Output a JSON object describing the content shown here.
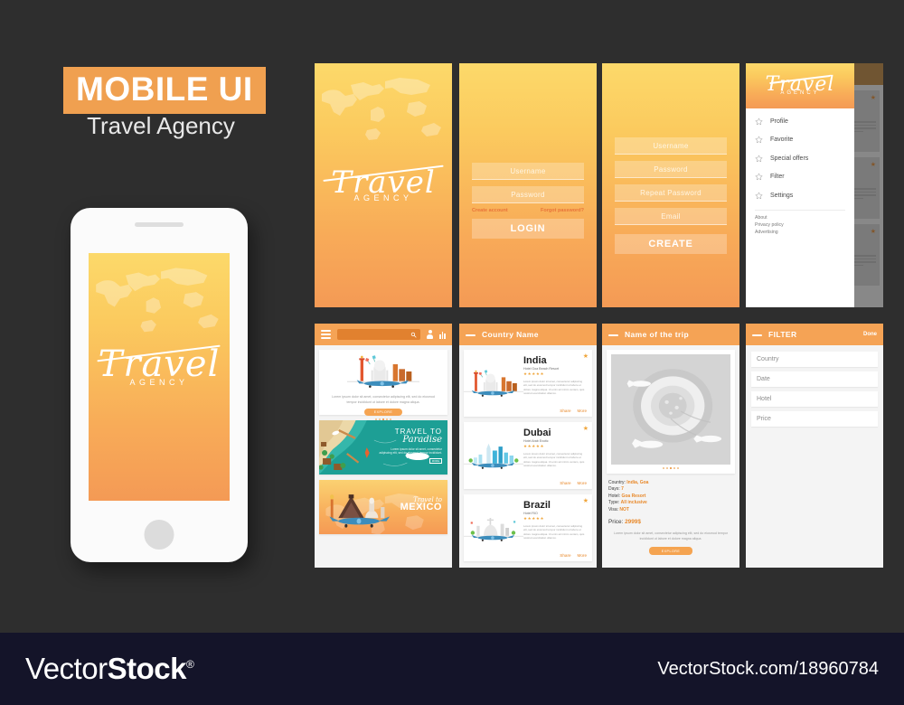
{
  "header": {
    "badge_title": "MOBILE UI",
    "subtitle": "Travel Agency",
    "badge_color": "#f0a050"
  },
  "brand": {
    "script": "Travel",
    "agency": "AGENCY"
  },
  "screens": {
    "splash": {
      "name": "splash-screen"
    },
    "login": {
      "username_placeholder": "Username",
      "password_placeholder": "Password",
      "create_account_link": "Create account",
      "forgot_password_link": "Forgot password?",
      "submit_label": "LOGIN"
    },
    "register": {
      "username_placeholder": "Username",
      "password_placeholder": "Password",
      "repeat_password_placeholder": "Repeat Password",
      "email_placeholder": "Email",
      "submit_label": "CREATE"
    },
    "drawer": {
      "items": [
        {
          "label": "Profile",
          "icon": "star-outline-icon"
        },
        {
          "label": "Favorite",
          "icon": "star-outline-icon"
        },
        {
          "label": "Special offers",
          "icon": "star-outline-icon"
        },
        {
          "label": "Filter",
          "icon": "star-outline-icon"
        },
        {
          "label": "Settings",
          "icon": "star-outline-icon"
        }
      ],
      "footer_links": [
        "About",
        "Privacy policy",
        "Advertising"
      ]
    },
    "home": {
      "search_placeholder": "",
      "hero": {
        "lorem": "Lorem ipsum dolor sit amet, consectetur adipiscing elit, sed do eiusmod tempor incididunt ut labore et dolore magna aliqua.",
        "cta": "EXPLORE"
      },
      "banners": [
        {
          "line1": "TRAVEL TO",
          "line2": "Paradise",
          "lorem": "Lorem ipsum dolor sit amet, consectetur adipiscing elit, sed do eiusmod tempor incididunt.",
          "cta": "MORE"
        },
        {
          "line1": "Travel to",
          "line2": "MEXICO"
        }
      ]
    },
    "country_list": {
      "title": "Country Name",
      "items": [
        {
          "country": "India",
          "hotel": "Hotel Goa Beach Resort",
          "stars": "★★★★★",
          "lorem": "Lorem ipsum dolor sit amet, consectetur adipiscing elit, sed do eiusmod tempor incididunt ut labore et dolore magna aliqua. Ut enim ad minim veniam, quis nostrud exercitation ullamco.",
          "share_label": "Share",
          "more_label": "More"
        },
        {
          "country": "Dubai",
          "hotel": "Hotel Arab Exotic",
          "stars": "★★★★★",
          "lorem": "Lorem ipsum dolor sit amet, consectetur adipiscing elit, sed do eiusmod tempor incididunt ut labore et dolore magna aliqua. Ut enim ad minim veniam, quis nostrud exercitation ullamco.",
          "share_label": "Share",
          "more_label": "More"
        },
        {
          "country": "Brazil",
          "hotel": "Hotel RIO",
          "stars": "★★★★★",
          "lorem": "Lorem ipsum dolor sit amet, consectetur adipiscing elit, sed do eiusmod tempor incididunt ut labore et dolore magna aliqua. Ut enim ad minim veniam, quis nostrud exercitation ullamco.",
          "share_label": "Share",
          "more_label": "More"
        }
      ]
    },
    "trip_detail": {
      "title": "Name of the trip",
      "specs": [
        {
          "label": "Country:",
          "value": "India, Goa"
        },
        {
          "label": "Days:",
          "value": "7"
        },
        {
          "label": "Hotel:",
          "value": "Goa Resort"
        },
        {
          "label": "Type:",
          "value": "All inclusive"
        },
        {
          "label": "Visa:",
          "value": "NOT"
        }
      ],
      "price_label": "Price:",
      "price_value": "2999$",
      "lorem": "Lorem ipsum dolor sit amet, consectetur adipiscing elit, sed do eiusmod tempor incididunt ut labore et dolore magna aliqua.",
      "cta": "EXPLORE"
    },
    "filter": {
      "title": "FILTER",
      "done_label": "Done",
      "fields": [
        "Country",
        "Date",
        "Hotel",
        "Price"
      ]
    }
  },
  "watermark": {
    "logo_part1": "Vector",
    "logo_part2": "Stock",
    "registered": "®",
    "url": "VectorStock.com/18960784"
  },
  "colors": {
    "background": "#2e2e2e",
    "accent_orange": "#f5a355",
    "deep_orange": "#e8892b",
    "teal": "#1d9f95",
    "watermark_bg": "#141429"
  }
}
